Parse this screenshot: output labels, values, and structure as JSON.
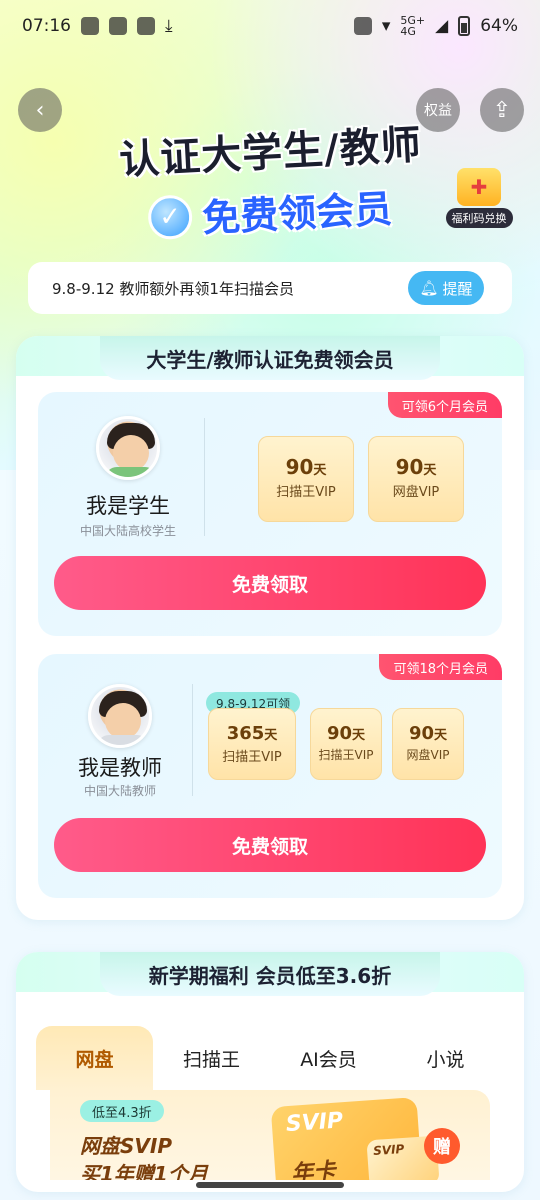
{
  "status_bar": {
    "time": "07:16",
    "network": "5G+",
    "network_sub": "4G",
    "battery": "64%"
  },
  "header": {
    "quanyi": "权益",
    "title_line1": "认证大学生/教师",
    "title_line2": "免费领会员",
    "gift_label": "福利码兑换"
  },
  "notice": {
    "text": "9.8-9.12 教师额外再领1年扫描会员",
    "remind_label": "提醒"
  },
  "section_main": {
    "title": "大学生/教师认证免费领会员",
    "student": {
      "ribbon": "可领6个月会员",
      "role": "我是学生",
      "role_sub": "中国大陆高校学生",
      "items": [
        {
          "days_num": "90",
          "days_unit": "天",
          "name": "扫描王VIP"
        },
        {
          "days_num": "90",
          "days_unit": "天",
          "name": "网盘VIP"
        }
      ],
      "cta": "免费领取"
    },
    "teacher": {
      "ribbon": "可领18个月会员",
      "role": "我是教师",
      "role_sub": "中国大陆教师",
      "tag": "9.8-9.12可领",
      "items": [
        {
          "days_num": "365",
          "days_unit": "天",
          "name": "扫描王VIP"
        },
        {
          "days_num": "90",
          "days_unit": "天",
          "name": "扫描王VIP"
        },
        {
          "days_num": "90",
          "days_unit": "天",
          "name": "网盘VIP"
        }
      ],
      "cta": "免费领取"
    }
  },
  "section_benefits": {
    "title": "新学期福利 会员低至3.6折",
    "tabs": [
      "网盘",
      "扫描王",
      "AI会员",
      "小说"
    ],
    "promo_tag": "低至4.3折",
    "promo_title": "网盘SVIP",
    "promo_title2": "买1年赠1个月",
    "card_label": "SVIP",
    "card_sub": "年卡",
    "mini_label": "SVIP",
    "zeng": "赠"
  }
}
